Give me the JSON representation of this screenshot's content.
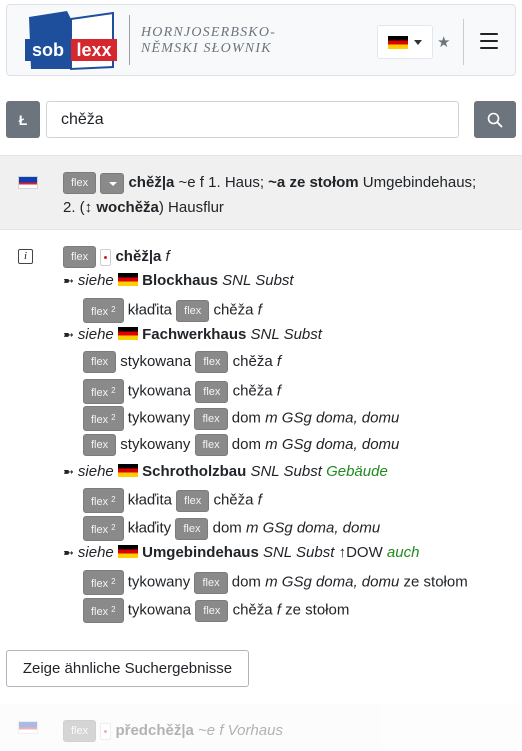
{
  "header": {
    "logo": {
      "word1": "sob",
      "word2": "lexx"
    },
    "title_line1": "HORNJOSERBSKO-",
    "title_line2": "NĚMSKI SŁOWNIK",
    "language_flag_icon": "flag-de-icon",
    "star_icon": "star-icon",
    "menu_icon": "hamburger-icon"
  },
  "search": {
    "letter_button": "Ł",
    "value": "chěža",
    "button_icon": "search-icon"
  },
  "results": [
    {
      "flex_label": "flex",
      "headword": "chěž|a",
      "grammar": "~e f 1. Haus;",
      "phrase": "~a ze stołom",
      "phrase_trans": "Umgebindehaus;",
      "sense2_prefix": "2. (↕",
      "sense2_word": "wochěža",
      "sense2_suffix": ") Hausflur"
    }
  ],
  "entry": {
    "flex_label": "flex",
    "headword": "chěž|a",
    "gender": "f",
    "arrow": "➼",
    "siehe": "siehe",
    "blocks": [
      {
        "word": "Blockhaus",
        "tags": "SNL Subst",
        "extra": "",
        "subs": [
          {
            "flex1": "flex",
            "sup1": "2",
            "w1": "kłaďita",
            "flex2": "flex",
            "w2": "chěža",
            "g2": "f",
            "rest": ""
          }
        ]
      },
      {
        "word": "Fachwerkhaus",
        "tags": "SNL Subst",
        "extra": "",
        "subs": [
          {
            "flex1": "flex",
            "sup1": "",
            "w1": "stykowana",
            "flex2": "flex",
            "w2": "chěža",
            "g2": "f",
            "rest": ""
          },
          {
            "flex1": "flex",
            "sup1": "2",
            "w1": "tykowana",
            "flex2": "flex",
            "w2": "chěža",
            "g2": "f",
            "rest": ""
          },
          {
            "flex1": "flex",
            "sup1": "2",
            "w1": "tykowany",
            "flex2": "flex",
            "w2": "dom",
            "g2": "m GSg doma, domu",
            "rest": ""
          },
          {
            "flex1": "flex",
            "sup1": "",
            "w1": "stykowany",
            "flex2": "flex",
            "w2": "dom",
            "g2": "m GSg doma, domu",
            "rest": ""
          }
        ]
      },
      {
        "word": "Schrotholzbau",
        "tags": "SNL Subst",
        "extra": "Gebäude",
        "subs": [
          {
            "flex1": "flex",
            "sup1": "2",
            "w1": "kłaďita",
            "flex2": "flex",
            "w2": "chěža",
            "g2": "f",
            "rest": ""
          },
          {
            "flex1": "flex",
            "sup1": "2",
            "w1": "kłaďity",
            "flex2": "flex",
            "w2": "dom",
            "g2": "m GSg doma, domu",
            "rest": ""
          }
        ]
      },
      {
        "word": "Umgebindehaus",
        "tags": "SNL Subst",
        "extra_plain": "↑DOW",
        "extra": "auch",
        "subs": [
          {
            "flex1": "flex",
            "sup1": "2",
            "w1": "tykowany",
            "flex2": "flex",
            "w2": "dom",
            "g2": "m GSg doma, domu",
            "rest": "ze stołom"
          },
          {
            "flex1": "flex",
            "sup1": "2",
            "w1": "tykowana",
            "flex2": "flex",
            "w2": "chěža",
            "g2": "f",
            "rest": "ze stołom"
          }
        ]
      }
    ]
  },
  "similar_button": "Zeige ähnliche Suchergebnisse",
  "faded_result": {
    "flex_label": "flex",
    "headword": "předchěž|a",
    "grammar": "~e f Vorhaus"
  },
  "colors": {
    "flex_bg": "#8a8a8a",
    "green_tag": "#1f8a1f",
    "logo_blue": "#1d4f9c",
    "logo_red": "#d6262e"
  }
}
